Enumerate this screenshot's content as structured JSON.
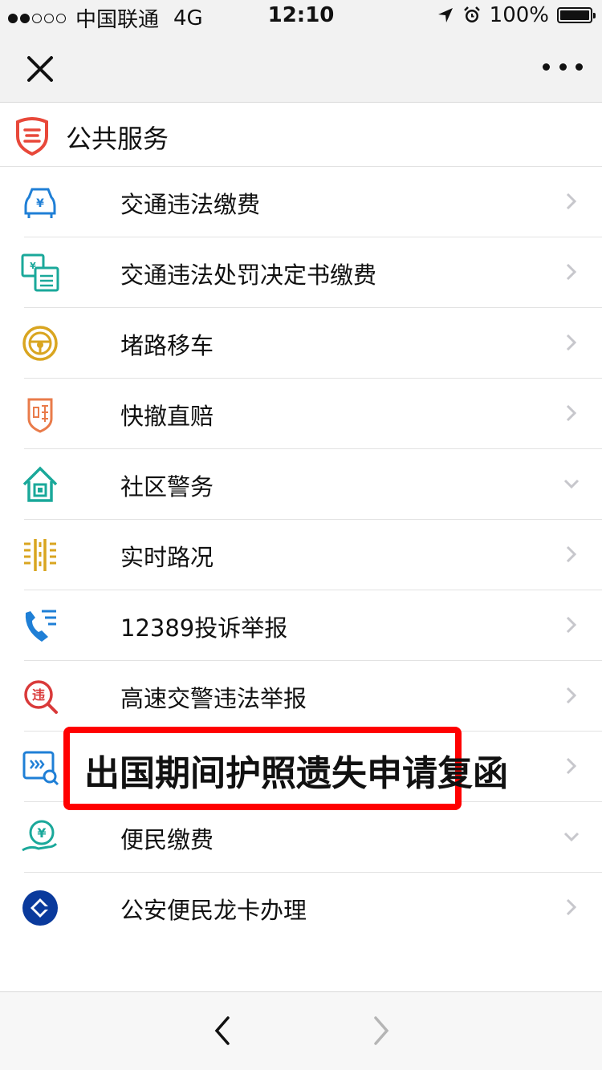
{
  "status_bar": {
    "carrier": "中国联通",
    "network": "4G",
    "time": "12:10",
    "battery": "100%"
  },
  "nav": {
    "close_icon": "close-icon",
    "more_icon": "more-icon"
  },
  "section": {
    "title": "公共服务",
    "icon": "shield-icon"
  },
  "items": [
    {
      "label": "交通违法缴费",
      "icon": "car-yuan-icon",
      "chevron": "right"
    },
    {
      "label": "交通违法处罚决定书缴费",
      "icon": "penalty-ticket-icon",
      "chevron": "right"
    },
    {
      "label": "堵路移车",
      "icon": "steering-wheel-icon",
      "chevron": "right"
    },
    {
      "label": "快撤直赔",
      "icon": "compensation-shield-icon",
      "chevron": "right"
    },
    {
      "label": "社区警务",
      "icon": "community-house-icon",
      "chevron": "down"
    },
    {
      "label": "实时路况",
      "icon": "road-lanes-icon",
      "chevron": "right"
    },
    {
      "label": "12389投诉举报",
      "icon": "phone-report-icon",
      "chevron": "right"
    },
    {
      "label": "高速交警违法举报",
      "icon": "violation-search-icon",
      "chevron": "right"
    },
    {
      "label": "",
      "icon": "passport-search-icon",
      "chevron": "right"
    },
    {
      "label": "便民缴费",
      "icon": "hand-yuan-icon",
      "chevron": "down"
    },
    {
      "label": "公安便民龙卡办理",
      "icon": "ccb-logo-icon",
      "chevron": "right"
    }
  ],
  "highlight": {
    "label": "出国期间护照遗失申请复函"
  },
  "colors": {
    "highlight_border": "#ff0000",
    "section_icon": "#e8483a",
    "blue_icon": "#1f7fd6",
    "teal_icon": "#1aa89a",
    "gold_icon": "#d9a520",
    "orange_icon": "#e97b4a",
    "red_icon": "#d93a3a",
    "ccb_blue": "#0a3a9c"
  }
}
